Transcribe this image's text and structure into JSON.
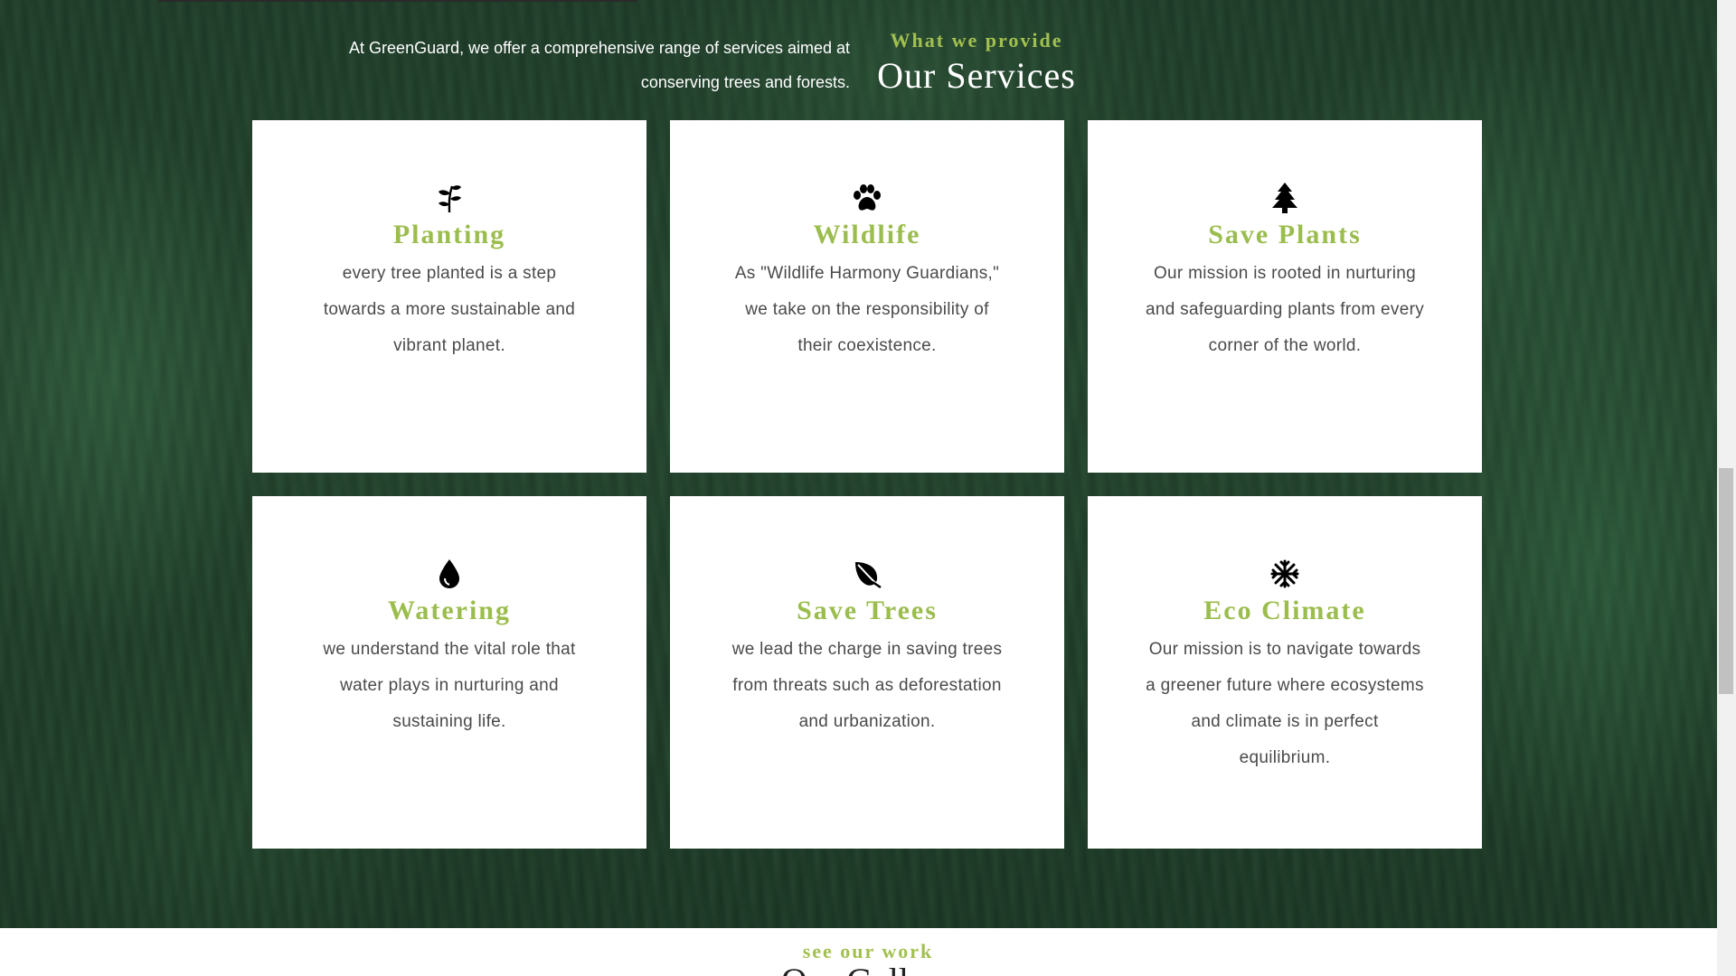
{
  "intro": {
    "line1": "At GreenGuard, we offer a comprehensive range of services aimed at",
    "line2": "conserving trees and forests."
  },
  "section": {
    "eyebrow": "What we provide",
    "title": "Our Services"
  },
  "cards": [
    {
      "icon": "seedling-icon",
      "title": "Planting",
      "text": "every tree planted is a step towards a more sustainable and vibrant planet."
    },
    {
      "icon": "paw-icon",
      "title": "Wildlife",
      "text": "As \"Wildlife Harmony Guardians,\" we take on the responsibility of their coexistence."
    },
    {
      "icon": "tree-icon",
      "title": "Save Plants",
      "text": "Our mission is rooted in nurturing and safeguarding plants from every corner of the world."
    },
    {
      "icon": "water-drop-icon",
      "title": "Watering",
      "text": "we understand the vital role that water plays in nurturing and sustaining life."
    },
    {
      "icon": "leaf-icon",
      "title": "Save Trees",
      "text": "we lead the charge in saving trees from threats such as deforestation and urbanization."
    },
    {
      "icon": "snowflake-icon",
      "title": "Eco Climate",
      "text": "Our mission is to navigate towards a greener future where ecosystems and climate is in perfect equilibrium."
    }
  ],
  "gallery": {
    "eyebrow": "see our work",
    "title": "Our Gallery"
  },
  "colors": {
    "accent": "#9bbd4d",
    "forest": "#1f3d2a",
    "card": "#ffffff"
  }
}
